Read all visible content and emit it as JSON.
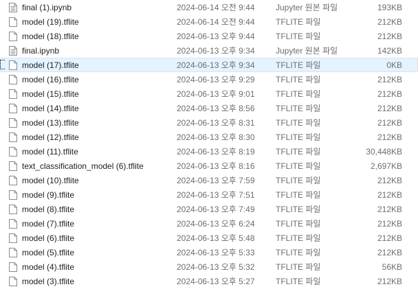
{
  "files": [
    {
      "name": "final (1).ipynb",
      "date": "2024-06-14 오전 9:44",
      "type": "Jupyter 원본 파일",
      "size": "193KB",
      "icon": "text-file-icon",
      "selected": false
    },
    {
      "name": "model (19).tflite",
      "date": "2024-06-14 오전 9:44",
      "type": "TFLITE 파일",
      "size": "212KB",
      "icon": "file-icon",
      "selected": false
    },
    {
      "name": "model (18).tflite",
      "date": "2024-06-13 오후 9:44",
      "type": "TFLITE 파일",
      "size": "212KB",
      "icon": "file-icon",
      "selected": false
    },
    {
      "name": "final.ipynb",
      "date": "2024-06-13 오후 9:34",
      "type": "Jupyter 원본 파일",
      "size": "142KB",
      "icon": "text-file-icon",
      "selected": false
    },
    {
      "name": "model (17).tflite",
      "date": "2024-06-13 오후 9:34",
      "type": "TFLITE 파일",
      "size": "0KB",
      "icon": "file-icon",
      "selected": true
    },
    {
      "name": "model (16).tflite",
      "date": "2024-06-13 오후 9:29",
      "type": "TFLITE 파일",
      "size": "212KB",
      "icon": "file-icon",
      "selected": false
    },
    {
      "name": "model (15).tflite",
      "date": "2024-06-13 오후 9:01",
      "type": "TFLITE 파일",
      "size": "212KB",
      "icon": "file-icon",
      "selected": false
    },
    {
      "name": "model (14).tflite",
      "date": "2024-06-13 오후 8:56",
      "type": "TFLITE 파일",
      "size": "212KB",
      "icon": "file-icon",
      "selected": false
    },
    {
      "name": "model (13).tflite",
      "date": "2024-06-13 오후 8:31",
      "type": "TFLITE 파일",
      "size": "212KB",
      "icon": "file-icon",
      "selected": false
    },
    {
      "name": "model (12).tflite",
      "date": "2024-06-13 오후 8:30",
      "type": "TFLITE 파일",
      "size": "212KB",
      "icon": "file-icon",
      "selected": false
    },
    {
      "name": "model (11).tflite",
      "date": "2024-06-13 오후 8:19",
      "type": "TFLITE 파일",
      "size": "30,448KB",
      "icon": "file-icon",
      "selected": false
    },
    {
      "name": "text_classification_model (6).tflite",
      "date": "2024-06-13 오후 8:16",
      "type": "TFLITE 파일",
      "size": "2,697KB",
      "icon": "file-icon",
      "selected": false
    },
    {
      "name": "model (10).tflite",
      "date": "2024-06-13 오후 7:59",
      "type": "TFLITE 파일",
      "size": "212KB",
      "icon": "file-icon",
      "selected": false
    },
    {
      "name": "model (9).tflite",
      "date": "2024-06-13 오후 7:51",
      "type": "TFLITE 파일",
      "size": "212KB",
      "icon": "file-icon",
      "selected": false
    },
    {
      "name": "model (8).tflite",
      "date": "2024-06-13 오후 7:49",
      "type": "TFLITE 파일",
      "size": "212KB",
      "icon": "file-icon",
      "selected": false
    },
    {
      "name": "model (7).tflite",
      "date": "2024-06-13 오후 6:24",
      "type": "TFLITE 파일",
      "size": "212KB",
      "icon": "file-icon",
      "selected": false
    },
    {
      "name": "model (6).tflite",
      "date": "2024-06-13 오후 5:48",
      "type": "TFLITE 파일",
      "size": "212KB",
      "icon": "file-icon",
      "selected": false
    },
    {
      "name": "model (5).tflite",
      "date": "2024-06-13 오후 5:33",
      "type": "TFLITE 파일",
      "size": "212KB",
      "icon": "file-icon",
      "selected": false
    },
    {
      "name": "model (4).tflite",
      "date": "2024-06-13 오후 5:32",
      "type": "TFLITE 파일",
      "size": "56KB",
      "icon": "file-icon",
      "selected": false
    },
    {
      "name": "model (3).tflite",
      "date": "2024-06-13 오후 5:27",
      "type": "TFLITE 파일",
      "size": "212KB",
      "icon": "file-icon",
      "selected": false
    }
  ]
}
